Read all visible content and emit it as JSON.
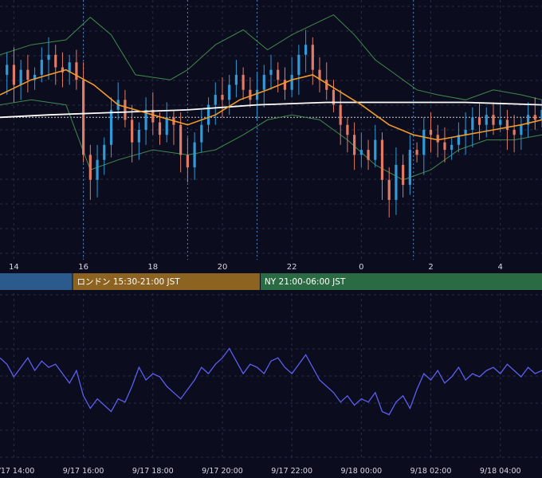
{
  "colors": {
    "background": "#0b0c1d",
    "grid": "#2a2d48",
    "up_candle": "#2f9bd8",
    "down_candle": "#e07b66",
    "ma_fast": "#ef9a2c",
    "ma_slow": "#ffffff",
    "bollinger": "#3f8a4d",
    "session_tokyo": "#2b5a8c",
    "session_london": "#8c6320",
    "session_ny": "#2b6b43",
    "oscillator": "#5d5ef0",
    "session_markers": "#4f88c8"
  },
  "sessions": [
    {
      "label": "",
      "color": "#2b5a8c"
    },
    {
      "label": "ロンドン 15:30-21:00 JST",
      "color": "#8c6320"
    },
    {
      "label": "NY 21:00-06:00 JST",
      "color": "#2b6b43"
    }
  ],
  "chart_data": [
    {
      "type": "candlestick",
      "title": "",
      "x_tick_labels": [
        "14",
        "16",
        "18",
        "20",
        "22",
        "0",
        "2",
        "4"
      ],
      "x_tick_hours": [
        14,
        16,
        18,
        20,
        22,
        24,
        26,
        28
      ],
      "x_range_hours": [
        13.6,
        29.2
      ],
      "y_range": [
        0,
        100
      ],
      "grid": true,
      "session_marker_hours": [
        16.0,
        19.0,
        21.0,
        25.5
      ],
      "reference_level": 55,
      "candles_close_path": [
        [
          13.6,
          72
        ],
        [
          13.8,
          76
        ],
        [
          14.0,
          68
        ],
        [
          14.2,
          74
        ],
        [
          14.4,
          70
        ],
        [
          14.6,
          72
        ],
        [
          14.8,
          78
        ],
        [
          15.0,
          80
        ],
        [
          15.2,
          75
        ],
        [
          15.4,
          73
        ],
        [
          15.6,
          77
        ],
        [
          15.8,
          70
        ],
        [
          16.0,
          40
        ],
        [
          16.2,
          30
        ],
        [
          16.4,
          38
        ],
        [
          16.6,
          44
        ],
        [
          16.8,
          58
        ],
        [
          17.0,
          62
        ],
        [
          17.2,
          54
        ],
        [
          17.4,
          45
        ],
        [
          17.6,
          50
        ],
        [
          17.8,
          58
        ],
        [
          18.0,
          53
        ],
        [
          18.2,
          48
        ],
        [
          18.4,
          55
        ],
        [
          18.6,
          52
        ],
        [
          18.8,
          40
        ],
        [
          19.0,
          35
        ],
        [
          19.2,
          45
        ],
        [
          19.4,
          52
        ],
        [
          19.6,
          60
        ],
        [
          19.8,
          64
        ],
        [
          20.0,
          62
        ],
        [
          20.2,
          68
        ],
        [
          20.4,
          72
        ],
        [
          20.6,
          66
        ],
        [
          20.8,
          62
        ],
        [
          21.0,
          66
        ],
        [
          21.2,
          72
        ],
        [
          21.4,
          74
        ],
        [
          21.6,
          70
        ],
        [
          21.8,
          66
        ],
        [
          22.0,
          72
        ],
        [
          22.2,
          80
        ],
        [
          22.4,
          84
        ],
        [
          22.6,
          74
        ],
        [
          22.8,
          70
        ],
        [
          23.0,
          66
        ],
        [
          23.2,
          60
        ],
        [
          23.4,
          52
        ],
        [
          23.6,
          48
        ],
        [
          23.8,
          40
        ],
        [
          24.0,
          42
        ],
        [
          24.2,
          38
        ],
        [
          24.4,
          46
        ],
        [
          24.6,
          30
        ],
        [
          24.8,
          22
        ],
        [
          25.0,
          36
        ],
        [
          25.2,
          28
        ],
        [
          25.4,
          42
        ],
        [
          25.6,
          40
        ],
        [
          25.8,
          50
        ],
        [
          26.0,
          48
        ],
        [
          26.2,
          45
        ],
        [
          26.4,
          42
        ],
        [
          26.6,
          44
        ],
        [
          26.8,
          48
        ],
        [
          27.0,
          50
        ],
        [
          27.2,
          55
        ],
        [
          27.4,
          52
        ],
        [
          27.6,
          56
        ],
        [
          27.8,
          52
        ],
        [
          28.0,
          54
        ],
        [
          28.2,
          50
        ],
        [
          28.4,
          48
        ],
        [
          28.6,
          52
        ],
        [
          28.8,
          56
        ],
        [
          29.0,
          54
        ],
        [
          29.2,
          58
        ]
      ],
      "ma_fast_path": [
        [
          13.6,
          64
        ],
        [
          14.5,
          70
        ],
        [
          15.5,
          74
        ],
        [
          16.3,
          68
        ],
        [
          17.0,
          60
        ],
        [
          18.0,
          56
        ],
        [
          19.0,
          52
        ],
        [
          19.8,
          56
        ],
        [
          20.5,
          62
        ],
        [
          21.3,
          66
        ],
        [
          22.0,
          70
        ],
        [
          22.6,
          72
        ],
        [
          23.3,
          66
        ],
        [
          24.0,
          60
        ],
        [
          24.8,
          52
        ],
        [
          25.5,
          48
        ],
        [
          26.2,
          46
        ],
        [
          27.0,
          48
        ],
        [
          27.8,
          50
        ],
        [
          28.6,
          52
        ],
        [
          29.2,
          54
        ]
      ],
      "ma_slow_path": [
        [
          13.6,
          55
        ],
        [
          15.0,
          56
        ],
        [
          17.0,
          57
        ],
        [
          19.0,
          58
        ],
        [
          21.0,
          60
        ],
        [
          23.0,
          61
        ],
        [
          25.0,
          61
        ],
        [
          27.0,
          61
        ],
        [
          29.2,
          60
        ]
      ],
      "bollinger_upper_path": [
        [
          13.6,
          80
        ],
        [
          14.5,
          84
        ],
        [
          15.5,
          86
        ],
        [
          16.2,
          95
        ],
        [
          16.8,
          88
        ],
        [
          17.5,
          72
        ],
        [
          18.5,
          70
        ],
        [
          19.0,
          74
        ],
        [
          19.8,
          84
        ],
        [
          20.6,
          90
        ],
        [
          21.3,
          82
        ],
        [
          22.0,
          88
        ],
        [
          22.6,
          92
        ],
        [
          23.2,
          96
        ],
        [
          23.8,
          88
        ],
        [
          24.4,
          78
        ],
        [
          25.0,
          72
        ],
        [
          25.6,
          66
        ],
        [
          26.2,
          64
        ],
        [
          27.0,
          62
        ],
        [
          27.8,
          66
        ],
        [
          28.6,
          64
        ],
        [
          29.2,
          62
        ]
      ],
      "bollinger_lower_path": [
        [
          13.6,
          60
        ],
        [
          14.5,
          62
        ],
        [
          15.5,
          60
        ],
        [
          16.2,
          34
        ],
        [
          17.0,
          38
        ],
        [
          18.0,
          42
        ],
        [
          19.0,
          40
        ],
        [
          19.8,
          42
        ],
        [
          20.6,
          48
        ],
        [
          21.3,
          54
        ],
        [
          22.0,
          56
        ],
        [
          22.8,
          54
        ],
        [
          23.6,
          46
        ],
        [
          24.4,
          36
        ],
        [
          25.2,
          30
        ],
        [
          26.0,
          34
        ],
        [
          26.8,
          42
        ],
        [
          27.6,
          46
        ],
        [
          28.4,
          46
        ],
        [
          29.2,
          48
        ]
      ]
    },
    {
      "type": "line",
      "title": "",
      "x_tick_labels": [
        "9/17 14:00",
        "9/17 16:00",
        "9/17 18:00",
        "9/17 20:00",
        "9/17 22:00",
        "9/18 00:00",
        "9/18 02:00",
        "9/18 04:00"
      ],
      "x_tick_hours": [
        14,
        16,
        18,
        20,
        22,
        24,
        26,
        28
      ],
      "x_range_hours": [
        13.6,
        29.2
      ],
      "y_range": [
        0,
        100
      ],
      "grid": true,
      "series": [
        {
          "values": [
            [
              13.6,
              62
            ],
            [
              13.8,
              58
            ],
            [
              14.0,
              50
            ],
            [
              14.2,
              56
            ],
            [
              14.4,
              62
            ],
            [
              14.6,
              54
            ],
            [
              14.8,
              60
            ],
            [
              15.0,
              56
            ],
            [
              15.2,
              58
            ],
            [
              15.4,
              52
            ],
            [
              15.6,
              46
            ],
            [
              15.8,
              54
            ],
            [
              16.0,
              38
            ],
            [
              16.2,
              30
            ],
            [
              16.4,
              36
            ],
            [
              16.6,
              32
            ],
            [
              16.8,
              28
            ],
            [
              17.0,
              36
            ],
            [
              17.2,
              34
            ],
            [
              17.4,
              44
            ],
            [
              17.6,
              56
            ],
            [
              17.8,
              48
            ],
            [
              18.0,
              52
            ],
            [
              18.2,
              50
            ],
            [
              18.4,
              44
            ],
            [
              18.6,
              40
            ],
            [
              18.8,
              36
            ],
            [
              19.0,
              42
            ],
            [
              19.2,
              48
            ],
            [
              19.4,
              56
            ],
            [
              19.6,
              52
            ],
            [
              19.8,
              58
            ],
            [
              20.0,
              62
            ],
            [
              20.2,
              68
            ],
            [
              20.4,
              60
            ],
            [
              20.6,
              52
            ],
            [
              20.8,
              58
            ],
            [
              21.0,
              56
            ],
            [
              21.2,
              52
            ],
            [
              21.4,
              60
            ],
            [
              21.6,
              62
            ],
            [
              21.8,
              56
            ],
            [
              22.0,
              52
            ],
            [
              22.2,
              58
            ],
            [
              22.4,
              64
            ],
            [
              22.6,
              56
            ],
            [
              22.8,
              48
            ],
            [
              23.0,
              44
            ],
            [
              23.2,
              40
            ],
            [
              23.4,
              34
            ],
            [
              23.6,
              38
            ],
            [
              23.8,
              32
            ],
            [
              24.0,
              36
            ],
            [
              24.2,
              34
            ],
            [
              24.4,
              40
            ],
            [
              24.6,
              28
            ],
            [
              24.8,
              26
            ],
            [
              25.0,
              34
            ],
            [
              25.2,
              38
            ],
            [
              25.4,
              30
            ],
            [
              25.6,
              42
            ],
            [
              25.8,
              52
            ],
            [
              26.0,
              48
            ],
            [
              26.2,
              54
            ],
            [
              26.4,
              46
            ],
            [
              26.6,
              50
            ],
            [
              26.8,
              56
            ],
            [
              27.0,
              48
            ],
            [
              27.2,
              52
            ],
            [
              27.4,
              50
            ],
            [
              27.6,
              54
            ],
            [
              27.8,
              56
            ],
            [
              28.0,
              52
            ],
            [
              28.2,
              58
            ],
            [
              28.4,
              54
            ],
            [
              28.6,
              50
            ],
            [
              28.8,
              56
            ],
            [
              29.0,
              52
            ],
            [
              29.2,
              54
            ]
          ]
        }
      ]
    }
  ]
}
